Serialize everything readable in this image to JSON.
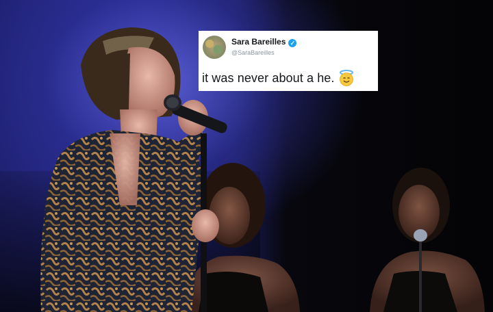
{
  "tweet": {
    "display_name": "Sara Bareilles",
    "handle": "@SaraBareilles",
    "text": "it was never about a he.",
    "verified_icon": "verified-badge-icon",
    "emoji": "smiling-face-with-halo"
  },
  "colors": {
    "verified": "#1da1f2",
    "stage_blue": "#2a2c95"
  }
}
